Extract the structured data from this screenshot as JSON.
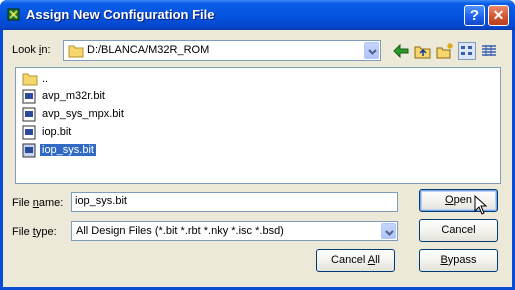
{
  "window": {
    "title": "Assign New Configuration File",
    "help_glyph": "?",
    "close_glyph": "✕"
  },
  "lookin": {
    "label_prefix": "Look ",
    "label_underlined": "i",
    "label_suffix": "n:",
    "path": "D:/BLANCA/M32R_ROM"
  },
  "toolbar": {
    "icons": [
      "back-arrow-icon",
      "up-folder-icon",
      "new-folder-icon",
      "list-view-icon",
      "details-view-icon"
    ]
  },
  "files": [
    {
      "name": "..",
      "icon": "folder-icon",
      "selected": false
    },
    {
      "name": "avp_m32r.bit",
      "icon": "file-icon",
      "selected": false
    },
    {
      "name": "avp_sys_mpx.bit",
      "icon": "file-icon",
      "selected": false
    },
    {
      "name": "iop.bit",
      "icon": "file-icon",
      "selected": false
    },
    {
      "name": "iop_sys.bit",
      "icon": "file-icon",
      "selected": true
    }
  ],
  "filename": {
    "label_prefix": "File ",
    "label_underlined": "n",
    "label_suffix": "ame:",
    "value": "iop_sys.bit"
  },
  "filetype": {
    "label_prefix": "File ",
    "label_underlined": "t",
    "label_suffix": "ype:",
    "value": "All Design Files (*.bit *.rbt *.nky *.isc *.bsd)"
  },
  "buttons": {
    "open_underlined": "O",
    "open_rest": "pen",
    "cancel": "Cancel",
    "cancel_all_prefix": "Cancel ",
    "cancel_all_underlined": "A",
    "cancel_all_suffix": "ll",
    "bypass_underlined": "B",
    "bypass_rest": "ypass"
  },
  "colors": {
    "title_bar": "#0654e0",
    "selection": "#316ac5",
    "dialog_face": "#ece9d8"
  }
}
